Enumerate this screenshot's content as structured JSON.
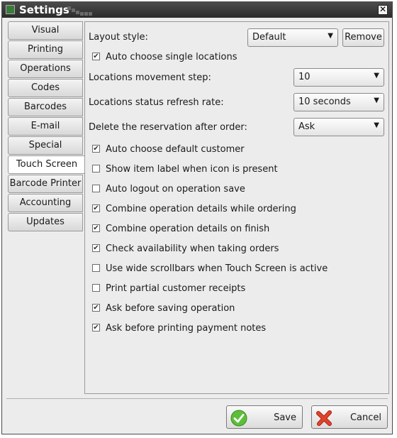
{
  "window": {
    "title": "Settings"
  },
  "tabs": [
    {
      "label": "Visual"
    },
    {
      "label": "Printing"
    },
    {
      "label": "Operations"
    },
    {
      "label": "Codes"
    },
    {
      "label": "Barcodes"
    },
    {
      "label": "E-mail"
    },
    {
      "label": "Special"
    },
    {
      "label": "Touch Screen"
    },
    {
      "label": "Barcode Printer"
    },
    {
      "label": "Accounting"
    },
    {
      "label": "Updates"
    }
  ],
  "active_tab": "Touch Screen",
  "layout": {
    "label": "Layout style:",
    "value": "Default",
    "remove_label": "Remove"
  },
  "auto_choose_single": {
    "label": "Auto choose single locations",
    "checked": true
  },
  "movement_step": {
    "label": "Locations movement step:",
    "value": "10"
  },
  "refresh_rate": {
    "label": "Locations status refresh rate:",
    "value": "10 seconds"
  },
  "delete_reservation": {
    "label": "Delete the reservation after order:",
    "value": "Ask"
  },
  "checks": [
    {
      "label": "Auto choose default customer",
      "checked": true
    },
    {
      "label": "Show item label when icon is present",
      "checked": false
    },
    {
      "label": "Auto logout on operation save",
      "checked": false
    },
    {
      "label": "Combine operation details while ordering",
      "checked": true
    },
    {
      "label": "Combine operation details on finish",
      "checked": true
    },
    {
      "label": "Check availability when taking orders",
      "checked": true
    },
    {
      "label": "Use wide scrollbars when Touch Screen is active",
      "checked": false
    },
    {
      "label": "Print partial customer receipts",
      "checked": false
    },
    {
      "label": "Ask before saving operation",
      "checked": true
    },
    {
      "label": "Ask before printing payment notes",
      "checked": true
    }
  ],
  "footer": {
    "save_label": "Save",
    "cancel_label": "Cancel"
  },
  "colors": {
    "titlebar": "#2b2b2b",
    "save_icon": "#5cbf3a",
    "cancel_icon": "#e0442a"
  }
}
